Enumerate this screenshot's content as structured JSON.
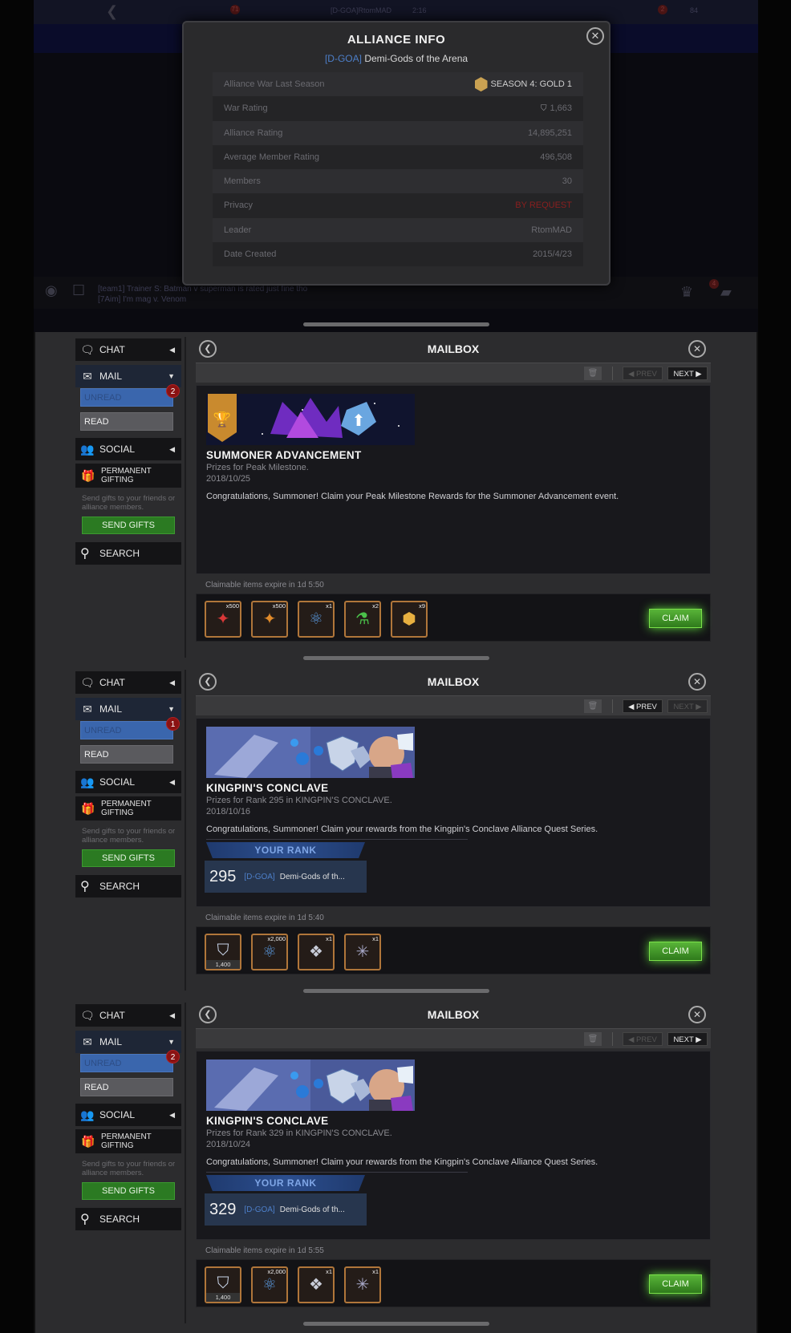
{
  "alliance_info": {
    "title": "ALLIANCE INFO",
    "tag": "[D-GOA]",
    "name": "Demi-Gods of the Arena",
    "close_icon": "close-icon",
    "rows": [
      {
        "label": "Alliance War Last Season",
        "value": "SEASON 4: GOLD 1"
      },
      {
        "label": "War Rating",
        "value": "1,663"
      },
      {
        "label": "Alliance Rating",
        "value": "14,895,251"
      },
      {
        "label": "Average Member Rating",
        "value": "496,508"
      },
      {
        "label": "Members",
        "value": "30"
      },
      {
        "label": "Privacy",
        "value": "BY REQUEST"
      },
      {
        "label": "Leader",
        "value": "RtomMAD"
      },
      {
        "label": "Date Created",
        "value": "2015/4/23"
      }
    ],
    "background": {
      "top_left_badge": "71",
      "top_player": "[D-GOA]RtomMAD",
      "top_timer": "2:16",
      "top_right_badge": "2",
      "top_right_count": "84",
      "chat_line_1": "[team1] Trainer S: Batman v superman is rated just fine tho",
      "chat_line_2": "[7Aim] I'm mag v. Venom",
      "bottom_right_badge": "4"
    }
  },
  "sidebar": {
    "chat": "CHAT",
    "mail": "MAIL",
    "unread": "UNREAD",
    "read": "READ",
    "social": "SOCIAL",
    "gifting": "PERMANENT GIFTING",
    "gifting_desc": "Send gifts to your friends or alliance members.",
    "send_gifts": "SEND GIFTS",
    "search": "SEARCH"
  },
  "mailbox": {
    "title": "MAILBOX",
    "prev": "◀ PREV",
    "next": "NEXT ▶",
    "claim": "CLAIM",
    "your_rank": "YOUR RANK"
  },
  "panels": [
    {
      "unread_count": "2",
      "prev_enabled": false,
      "next_enabled": true,
      "title": "SUMMONER ADVANCEMENT",
      "subtitle": "Prizes for Peak Milestone.",
      "date": "2018/10/25",
      "body": "Congratulations, Summoner! Claim your Peak Milestone Rewards for the Summoner Advancement event.",
      "expire": "Claimable items expire in 1d 5:50",
      "rewards": [
        {
          "icon": "red-crystal-icon",
          "qty": "x500"
        },
        {
          "icon": "orange-crystal-icon",
          "qty": "x500"
        },
        {
          "icon": "catalyst-icon",
          "qty": "x1"
        },
        {
          "icon": "potion-icon",
          "qty": "x2"
        },
        {
          "icon": "gold-crystal-icon",
          "qty": "x9"
        }
      ]
    },
    {
      "unread_count": "1",
      "prev_enabled": true,
      "next_enabled": false,
      "title": "KINGPIN'S CONCLAVE",
      "subtitle": "Prizes for Rank 295 in KINGPIN'S CONCLAVE.",
      "date": "2018/10/16",
      "body": "Congratulations, Summoner! Claim your rewards from the Kingpin's Conclave Alliance Quest Series.",
      "rank": "295",
      "rank_tag": "[D-GOA]",
      "rank_name": "Demi-Gods of th...",
      "expire": "Claimable items expire in 1d 5:40",
      "rewards": [
        {
          "icon": "shield-icon",
          "qty": "",
          "sub": "1,400"
        },
        {
          "icon": "catalyst-icon",
          "qty": "x2,000"
        },
        {
          "icon": "crystal-icon",
          "qty": "x1"
        },
        {
          "icon": "constellation-icon",
          "qty": "x1"
        }
      ]
    },
    {
      "unread_count": "2",
      "prev_enabled": false,
      "next_enabled": true,
      "title": "KINGPIN'S CONCLAVE",
      "subtitle": "Prizes for Rank 329 in KINGPIN'S CONCLAVE.",
      "date": "2018/10/24",
      "body": "Congratulations, Summoner! Claim your rewards from the Kingpin's Conclave Alliance Quest Series.",
      "rank": "329",
      "rank_tag": "[D-GOA]",
      "rank_name": "Demi-Gods of th...",
      "expire": "Claimable items expire in 1d 5:55",
      "rewards": [
        {
          "icon": "shield-icon",
          "qty": "",
          "sub": "1,400"
        },
        {
          "icon": "catalyst-icon",
          "qty": "x2,000"
        },
        {
          "icon": "crystal-icon",
          "qty": "x1"
        },
        {
          "icon": "constellation-icon",
          "qty": "x1"
        }
      ]
    }
  ]
}
